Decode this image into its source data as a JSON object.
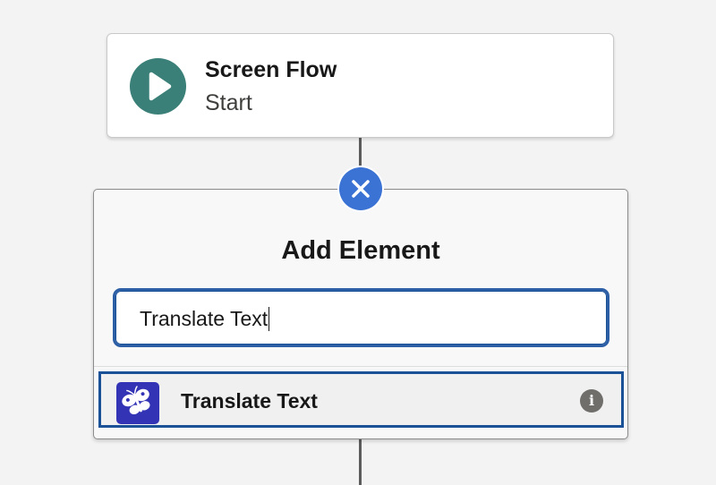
{
  "start_node": {
    "title": "Screen Flow",
    "subtitle": "Start",
    "icon": "play-icon",
    "icon_color": "#3a8078"
  },
  "add_element": {
    "title": "Add Element",
    "close_icon": "close-icon",
    "close_color": "#3b73d4",
    "search": {
      "value": "Translate Text"
    },
    "results": [
      {
        "label": "Translate Text",
        "icon": "butterfly-icon",
        "icon_color": "#3233b5",
        "info_icon": "info-icon",
        "info_glyph": "i"
      }
    ]
  }
}
